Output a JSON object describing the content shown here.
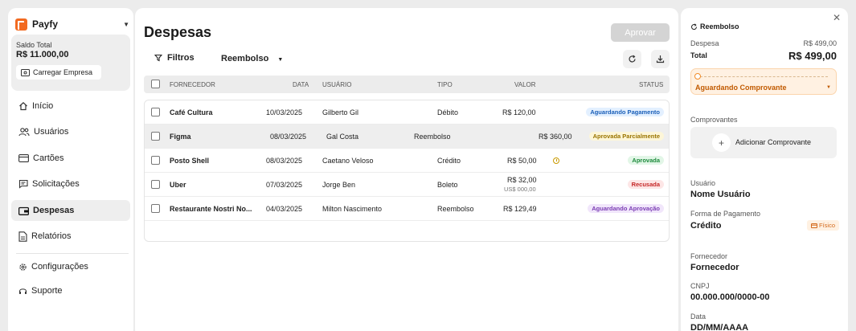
{
  "brand": {
    "name": "Payfy"
  },
  "balance": {
    "label": "Saldo Total",
    "value": "R$ 11.000,00",
    "load_button": "Carregar Empresa"
  },
  "nav": {
    "items": [
      {
        "label": "Início",
        "icon": "home-icon"
      },
      {
        "label": "Usuários",
        "icon": "users-icon"
      },
      {
        "label": "Cartões",
        "icon": "card-icon"
      },
      {
        "label": "Solicitações",
        "icon": "message-icon"
      },
      {
        "label": "Despesas",
        "icon": "wallet-icon",
        "active": true
      },
      {
        "label": "Relatórios",
        "icon": "report-icon"
      }
    ],
    "footer": [
      {
        "label": "Configurações",
        "icon": "gear-icon"
      },
      {
        "label": "Suporte",
        "icon": "headset-icon"
      }
    ]
  },
  "main": {
    "title": "Despesas",
    "approve_button": "Aprovar",
    "filters_label": "Filtros",
    "type_filter": "Reembolso",
    "columns": {
      "supplier": "FORNECEDOR",
      "date": "DATA",
      "user": "USUÁRIO",
      "type": "TIPO",
      "value": "VALOR",
      "status": "STATUS"
    },
    "rows": [
      {
        "supplier": "Café Cultura",
        "date": "10/03/2025",
        "user": "Gilberto Gil",
        "type": "Débito",
        "value": "R$ 120,00",
        "subvalue": "",
        "status": "Aguardando Pagamento",
        "status_color": "#1b5fb8"
      },
      {
        "supplier": "Figma",
        "date": "08/03/2025",
        "user": "Gal Costa",
        "type": "Reembolso",
        "value": "R$ 360,00",
        "subvalue": "",
        "status": "Aprovada Parcialmente",
        "status_color": "#9a7400"
      },
      {
        "supplier": "Posto Shell",
        "date": "08/03/2025",
        "user": "Caetano Veloso",
        "type": "Crédito",
        "value": "R$ 50,00",
        "subvalue": "",
        "status": "Aprovada",
        "status_color": "#1d8a3c"
      },
      {
        "supplier": "Uber",
        "date": "07/03/2025",
        "user": "Jorge Ben",
        "type": "Boleto",
        "value": "R$ 32,00",
        "subvalue": "US$ 000,00",
        "status": "Recusada",
        "status_color": "#c62828"
      },
      {
        "supplier": "Restaurante Nostri No...",
        "date": "04/03/2025",
        "user": "Milton Nascimento",
        "type": "Reembolso",
        "value": "R$ 129,49",
        "subvalue": "",
        "status": "Aguardando Aprovação",
        "status_color": "#7a3cb3"
      }
    ]
  },
  "panel": {
    "title": "Reembolso",
    "expense_label": "Despesa",
    "expense_value": "R$ 499,00",
    "total_label": "Total",
    "total_value": "R$ 499,00",
    "status": "Aguardando Comprovante",
    "proofs_label": "Comprovantes",
    "add_proof": "Adicionar Comprovante",
    "user_label": "Usuário",
    "user_value": "Nome Usuário",
    "payment_label": "Forma de Pagamento",
    "payment_value": "Crédito",
    "payment_badge": "Físico",
    "supplier_label": "Fornecedor",
    "supplier_value": "Fornecedor",
    "cnpj_label": "CNPJ",
    "cnpj_value": "00.000.000/0000-00",
    "date_label": "Data",
    "date_value": "DD/MM/AAAA"
  },
  "colors": {
    "brand": "#f26a21",
    "accent_orange": "#c15a00",
    "approve_disabled": "#d4d4d4"
  }
}
